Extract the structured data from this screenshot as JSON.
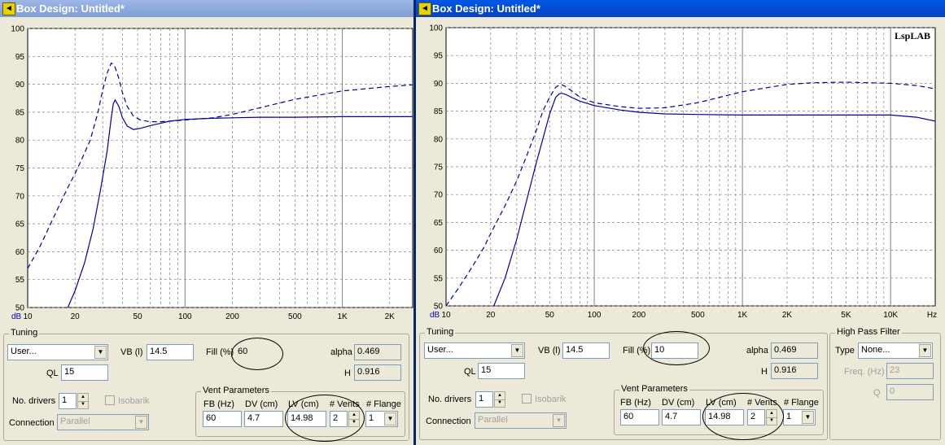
{
  "windows": [
    {
      "title": "Box Design: Untitled*",
      "watermark": "",
      "y_ticks": [
        "100",
        "95",
        "90",
        "85",
        "80",
        "75",
        "70",
        "65",
        "60",
        "55",
        "50"
      ],
      "x_ticks": [
        "10",
        "20",
        "50",
        "100",
        "200",
        "500",
        "1K",
        "2K"
      ],
      "y_unit": "dB",
      "x_unit": "",
      "tuning": {
        "label": "Tuning",
        "mode": "User...",
        "vb_label": "VB (l)",
        "vb": "14.5",
        "fill_label": "Fill (%)",
        "fill": "60",
        "alpha_label": "alpha",
        "alpha": "0.469",
        "h_label": "H",
        "h": "0.916",
        "ql_label": "QL",
        "ql": "15",
        "drivers_label": "No. drivers",
        "drivers": "1",
        "isobarik_label": "Isobarik",
        "connection_label": "Connection",
        "connection": "Parallel"
      },
      "vent": {
        "label": "Vent Parameters",
        "fb_label": "FB (Hz)",
        "fb": "60",
        "dv_label": "DV (cm)",
        "dv": "4.7",
        "lv_label": "LV (cm)",
        "lv": "14.98",
        "vents_label": "# Vents",
        "vents": "2",
        "flange_label": "# Flange",
        "flange": "1"
      }
    },
    {
      "title": "Box Design: Untitled*",
      "watermark": "LspLAB",
      "y_ticks": [
        "100",
        "95",
        "90",
        "85",
        "80",
        "75",
        "70",
        "65",
        "60",
        "55",
        "50"
      ],
      "x_ticks": [
        "10",
        "20",
        "50",
        "100",
        "200",
        "500",
        "1K",
        "2K",
        "5K",
        "10K",
        "Hz"
      ],
      "y_unit": "dB",
      "x_unit": "Hz",
      "tuning": {
        "label": "Tuning",
        "mode": "User...",
        "vb_label": "VB (l)",
        "vb": "14.5",
        "fill_label": "Fill (%)",
        "fill": "10",
        "alpha_label": "alpha",
        "alpha": "0.469",
        "h_label": "H",
        "h": "0.916",
        "ql_label": "QL",
        "ql": "15",
        "drivers_label": "No. drivers",
        "drivers": "1",
        "isobarik_label": "Isobarik",
        "connection_label": "Connection",
        "connection": "Parallel"
      },
      "vent": {
        "label": "Vent Parameters",
        "fb_label": "FB (Hz)",
        "fb": "60",
        "dv_label": "DV (cm)",
        "dv": "4.7",
        "lv_label": "LV (cm)",
        "lv": "14.98",
        "vents_label": "# Vents",
        "vents": "2",
        "flange_label": "# Flange",
        "flange": "1"
      },
      "hpf": {
        "label": "High Pass Filter",
        "type_label": "Type",
        "type": "None...",
        "freq_label": "Freq. (Hz)",
        "freq": "23",
        "q_label": "Q",
        "q": "0"
      }
    }
  ],
  "colors": {
    "curve": "#0000a0",
    "grid": "#808080",
    "title_active": "#0054e3",
    "title_inactive": "#8aa6dc"
  },
  "chart_data": [
    {
      "type": "line",
      "title": "",
      "xlabel": "",
      "ylabel": "dB",
      "x_scale": "log",
      "xlim": [
        10,
        2800
      ],
      "ylim": [
        50,
        100
      ],
      "grid": true,
      "series": [
        {
          "style": "solid",
          "x": [
            18,
            20,
            23,
            26,
            29,
            32,
            34,
            35,
            36,
            38,
            40,
            43,
            47,
            52,
            60,
            70,
            80,
            100,
            150,
            200,
            300,
            500,
            1000,
            2000,
            2800
          ],
          "y": [
            50,
            53,
            58,
            64,
            71,
            78,
            84,
            86.5,
            87.2,
            86,
            84,
            82.5,
            81.9,
            82.1,
            82.6,
            83,
            83.4,
            83.7,
            83.9,
            84,
            84.1,
            84.1,
            84.2,
            84.2,
            84.2
          ]
        },
        {
          "style": "dashed",
          "x": [
            10,
            12,
            14,
            16,
            18,
            20,
            22,
            25,
            28,
            30,
            32,
            34,
            35,
            36,
            38,
            40,
            43,
            47,
            52,
            60,
            70,
            80,
            100,
            150,
            200,
            300,
            500,
            1000,
            2000,
            2800
          ],
          "y": [
            57,
            61,
            65,
            68.5,
            71.5,
            74,
            76.5,
            80,
            85,
            89,
            92,
            93.8,
            93.6,
            93,
            91,
            88.5,
            86,
            84.3,
            83.6,
            83.3,
            83.3,
            83.4,
            83.6,
            84,
            84.6,
            85.8,
            87.3,
            88.8,
            89.6,
            89.9
          ]
        }
      ]
    },
    {
      "type": "line",
      "title": "",
      "xlabel": "Hz",
      "ylabel": "dB",
      "x_scale": "log",
      "xlim": [
        10,
        20000
      ],
      "ylim": [
        50,
        100
      ],
      "grid": true,
      "series": [
        {
          "style": "solid",
          "x": [
            21,
            25,
            30,
            35,
            40,
            45,
            50,
            55,
            58,
            60,
            63,
            70,
            80,
            100,
            150,
            200,
            300,
            500,
            1000,
            2000,
            5000,
            10000,
            15000,
            20000
          ],
          "y": [
            50,
            55,
            62,
            69,
            75,
            80,
            84.5,
            87.5,
            88.1,
            88.2,
            88.1,
            87.5,
            86.8,
            86,
            85.2,
            84.8,
            84.5,
            84.4,
            84.3,
            84.3,
            84.3,
            84.3,
            83.9,
            83.2
          ]
        },
        {
          "style": "dashed",
          "x": [
            10,
            12,
            15,
            18,
            20,
            25,
            30,
            35,
            40,
            45,
            50,
            55,
            58,
            60,
            63,
            70,
            80,
            100,
            150,
            200,
            300,
            500,
            1000,
            2000,
            3000,
            5000,
            10000,
            15000,
            20000
          ],
          "y": [
            50,
            53,
            57,
            60.5,
            63,
            68,
            72.5,
            77,
            81,
            85,
            87.5,
            89.3,
            89.7,
            89.8,
            89.5,
            88.7,
            87.5,
            86.5,
            85.8,
            85.5,
            85.6,
            86.5,
            88.5,
            89.8,
            90.1,
            90.2,
            90,
            89.6,
            89
          ]
        }
      ]
    }
  ]
}
